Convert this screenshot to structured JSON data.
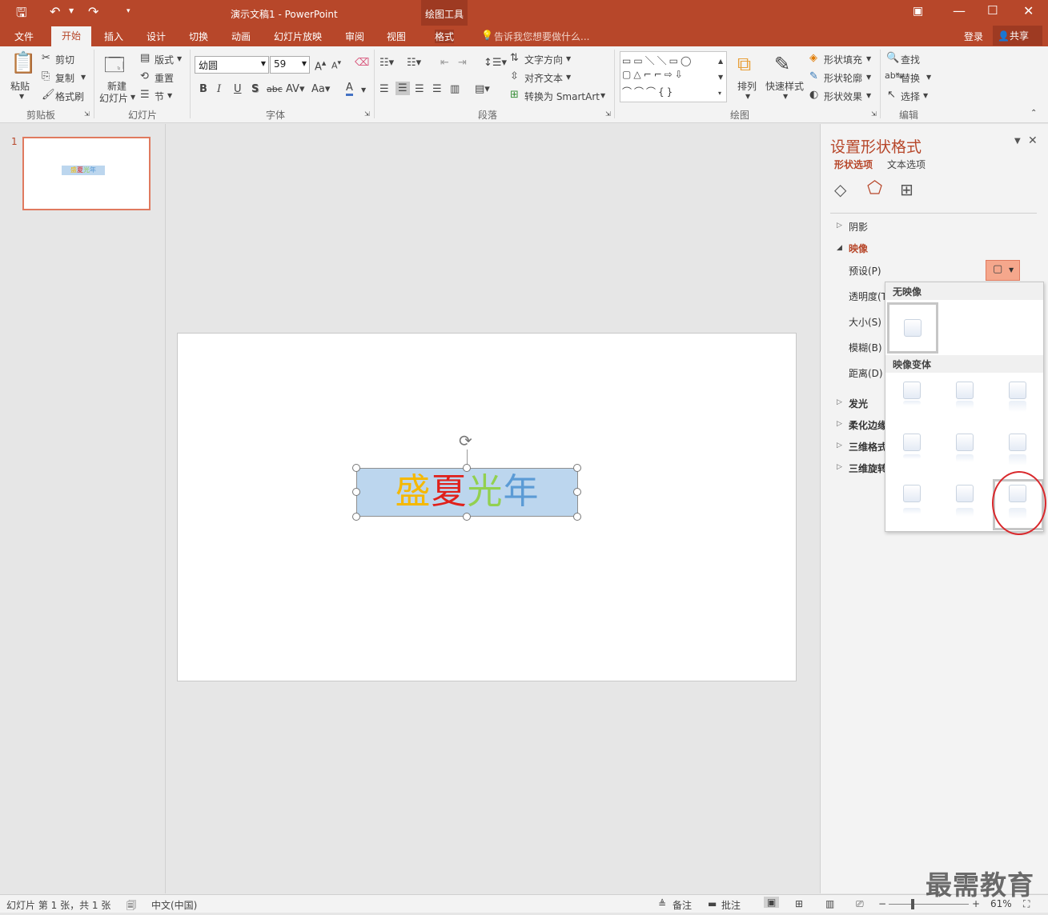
{
  "title": {
    "doc": "演示文稿1",
    "sep": " - ",
    "app": "PowerPoint",
    "context_tools": "绘图工具"
  },
  "tabs": [
    "文件",
    "开始",
    "插入",
    "设计",
    "切换",
    "动画",
    "幻灯片放映",
    "审阅",
    "视图",
    "格式"
  ],
  "tell_me": "告诉我您想要做什么...",
  "signin": "登录",
  "share": "共享",
  "ribbon": {
    "clipboard": {
      "paste": "粘贴",
      "cut": "剪切",
      "copy": "复制",
      "painter": "格式刷",
      "label": "剪贴板"
    },
    "slides": {
      "new1": "新建",
      "new2": "幻灯片",
      "layout": "版式",
      "reset": "重置",
      "section": "节",
      "label": "幻灯片"
    },
    "font": {
      "name": "幼圆",
      "size": "59",
      "label": "字体"
    },
    "paragraph": {
      "direction": "文字方向",
      "align": "对齐文本",
      "smartart": "转换为 SmartArt",
      "label": "段落"
    },
    "drawing": {
      "arrange": "排列",
      "quick": "快速样式",
      "fill": "形状填充",
      "outline": "形状轮廓",
      "effect": "形状效果",
      "label": "绘图"
    },
    "editing": {
      "find": "查找",
      "replace": "替换",
      "select": "选择",
      "label": "编辑"
    }
  },
  "slide_number": "1",
  "textbox_chars": [
    {
      "ch": "盛",
      "color": "#f5b800"
    },
    {
      "ch": "夏",
      "color": "#e0201b"
    },
    {
      "ch": "光",
      "color": "#92d050"
    },
    {
      "ch": "年",
      "color": "#5b9bd5"
    }
  ],
  "pane": {
    "title": "设置形状格式",
    "tab_shape": "形状选项",
    "tab_text": "文本选项",
    "shadow": "阴影",
    "reflection": "映像",
    "preset": "预设(P)",
    "transparency": "透明度(T)",
    "size": "大小(S)",
    "blur": "模糊(B)",
    "distance": "距离(D)",
    "glow": "发光",
    "soft_edges": "柔化边缘",
    "format3d": "三维格式",
    "rotation3d": "三维旋转"
  },
  "dropdown": {
    "no_reflection": "无映像",
    "variants": "映像变体"
  },
  "status": {
    "slide_info": "幻灯片 第 1 张，共 1 张",
    "lang": "中文(中国)",
    "notes": "备注",
    "comments": "批注",
    "zoom": "61%"
  },
  "watermark": "最需教育"
}
